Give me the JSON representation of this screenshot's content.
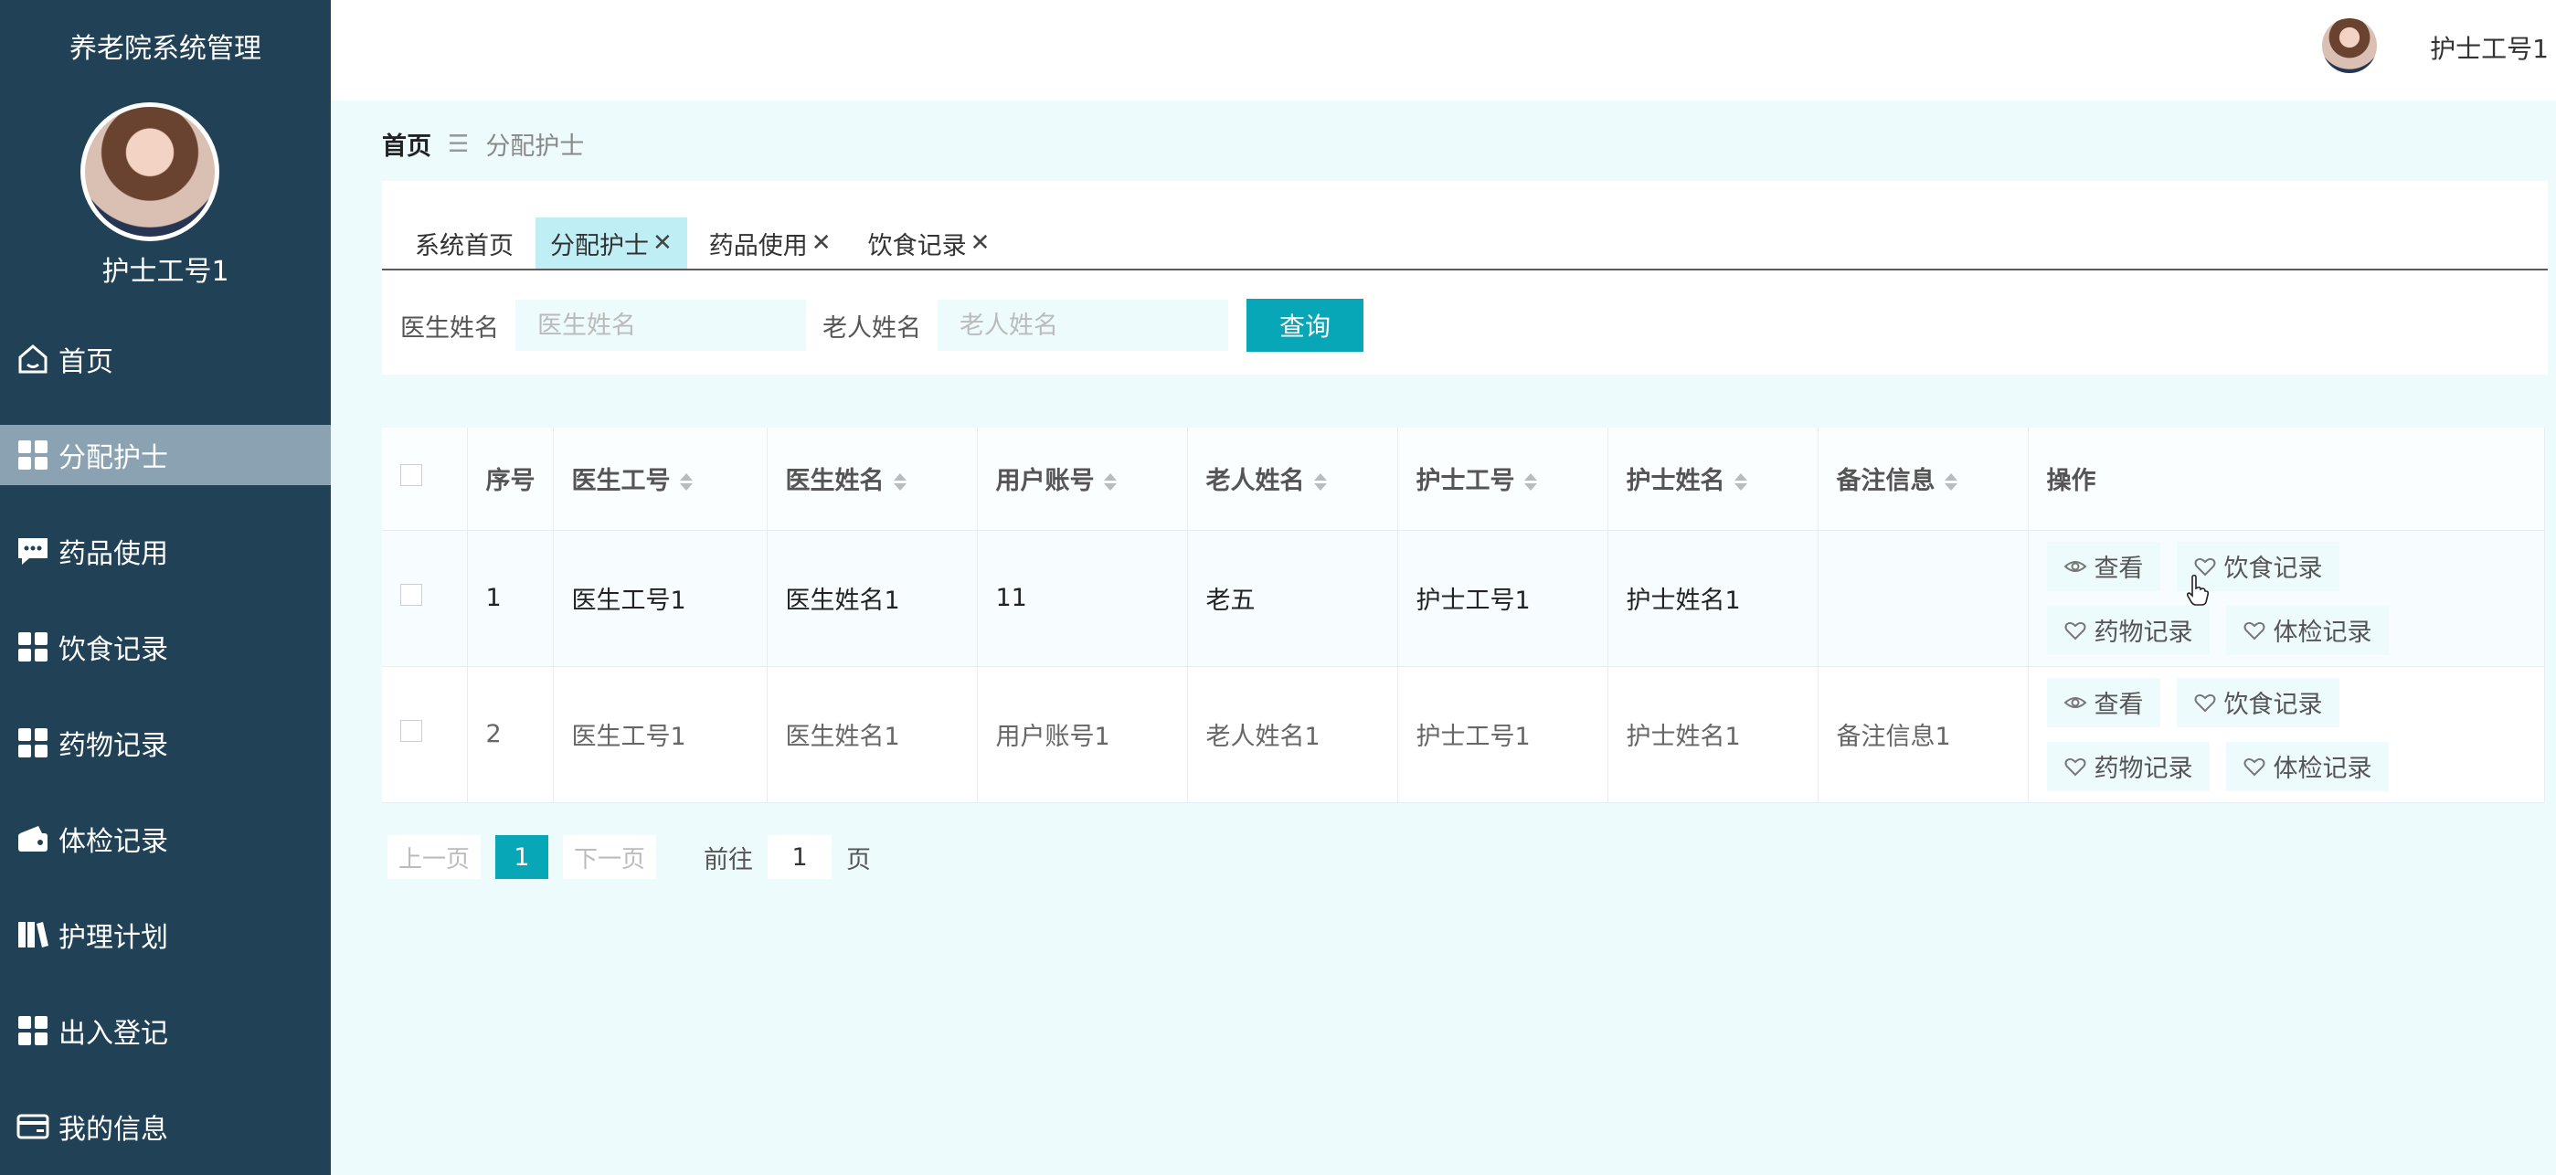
{
  "app": {
    "title": "养老院系统管理"
  },
  "sidebar": {
    "username": "护士工号1",
    "items": [
      {
        "label": "首页",
        "icon": "home-icon"
      },
      {
        "label": "分配护士",
        "icon": "grid-icon",
        "active": true
      },
      {
        "label": "药品使用",
        "icon": "chat-icon"
      },
      {
        "label": "饮食记录",
        "icon": "grid-icon"
      },
      {
        "label": "药物记录",
        "icon": "grid-icon"
      },
      {
        "label": "体检记录",
        "icon": "wallet-icon"
      },
      {
        "label": "护理计划",
        "icon": "book-icon"
      },
      {
        "label": "出入登记",
        "icon": "grid-icon"
      },
      {
        "label": "我的信息",
        "icon": "card-icon"
      }
    ]
  },
  "header": {
    "username": "护士工号1"
  },
  "breadcrumb": {
    "home": "首页",
    "separator": "☰",
    "current": "分配护士"
  },
  "tabs": [
    {
      "label": "系统首页",
      "closable": false
    },
    {
      "label": "分配护士",
      "closable": true,
      "active": true
    },
    {
      "label": "药品使用",
      "closable": true
    },
    {
      "label": "饮食记录",
      "closable": true
    }
  ],
  "search": {
    "doctor_label": "医生姓名",
    "doctor_placeholder": "医生姓名",
    "elder_label": "老人姓名",
    "elder_placeholder": "老人姓名",
    "button": "查询"
  },
  "table": {
    "columns": [
      "序号",
      "医生工号",
      "医生姓名",
      "用户账号",
      "老人姓名",
      "护士工号",
      "护士姓名",
      "备注信息",
      "操作"
    ],
    "rows": [
      {
        "index": "1",
        "doctor_id": "医生工号1",
        "doctor_name": "医生姓名1",
        "account": "11",
        "elder_name": "老五",
        "nurse_id": "护士工号1",
        "nurse_name": "护士姓名1",
        "remark": ""
      },
      {
        "index": "2",
        "doctor_id": "医生工号1",
        "doctor_name": "医生姓名1",
        "account": "用户账号1",
        "elder_name": "老人姓名1",
        "nurse_id": "护士工号1",
        "nurse_name": "护士姓名1",
        "remark": "备注信息1"
      }
    ],
    "actions": {
      "view": "查看",
      "diet": "饮食记录",
      "medicine": "药物记录",
      "checkup": "体检记录"
    }
  },
  "pagination": {
    "prev": "上一页",
    "page": "1",
    "next": "下一页",
    "goto_label": "前往",
    "goto_value": "1",
    "page_suffix": "页"
  },
  "colors": {
    "sidebar_bg": "#214156",
    "active_item_bg": "#8aa2b1",
    "accent": "#08a7b8",
    "content_bg": "#eefbfd",
    "active_tab_bg": "#bfeff5"
  }
}
